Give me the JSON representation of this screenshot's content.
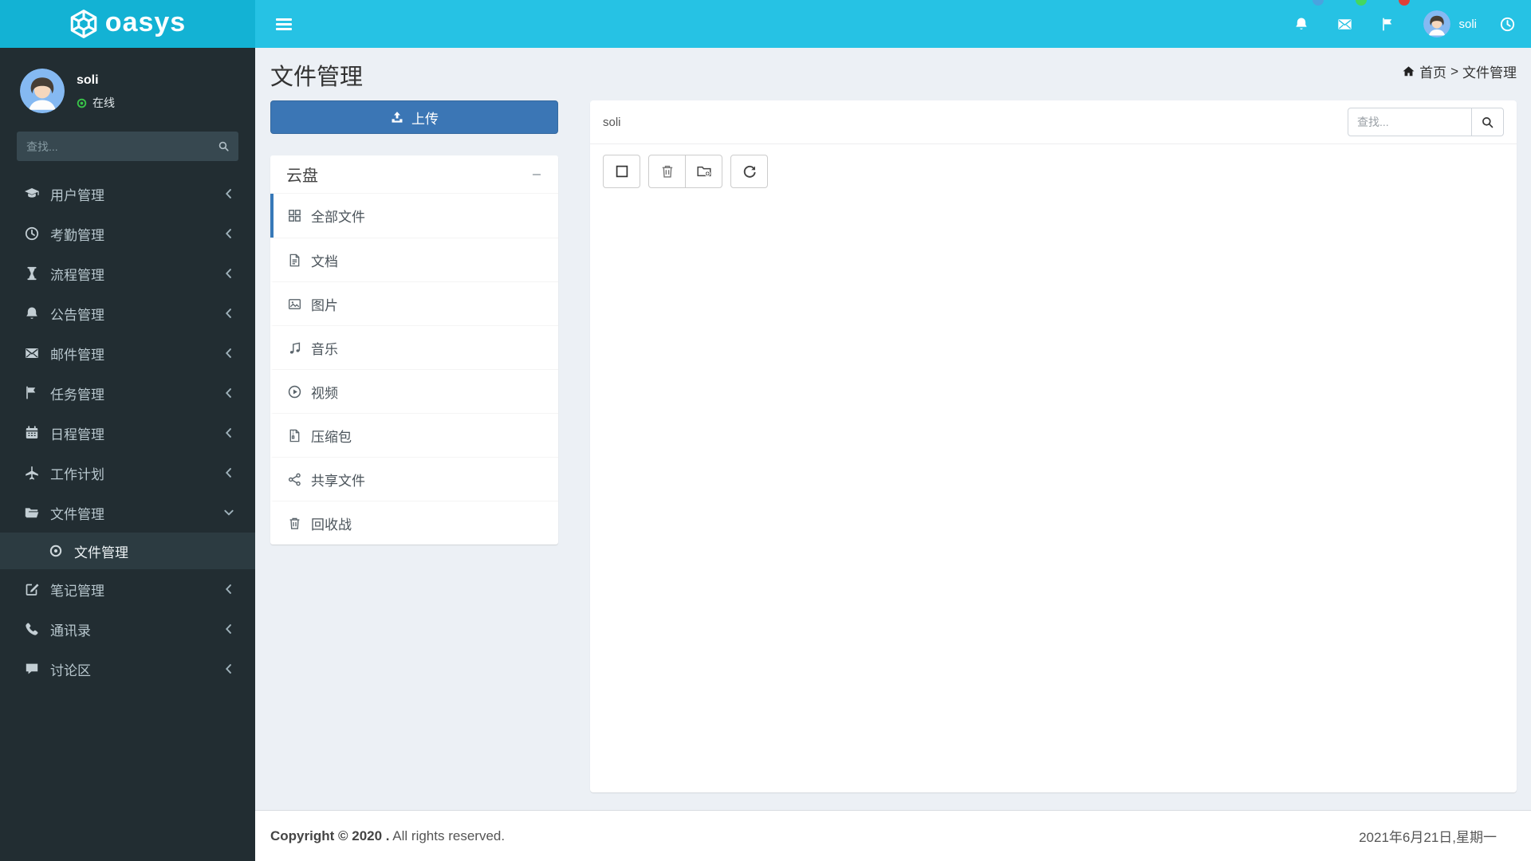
{
  "brand": {
    "logo_text": "oasys"
  },
  "topbar": {
    "username": "soli",
    "icons": [
      {
        "name": "bell",
        "badge_color": "#4aa3df"
      },
      {
        "name": "envelope",
        "badge_color": "#44d75f"
      },
      {
        "name": "flag",
        "badge_color": "#e04038"
      },
      {
        "name": "clock",
        "badge_color": null
      }
    ]
  },
  "sidebar": {
    "user": {
      "name": "soli",
      "status_label": "在线"
    },
    "search": {
      "placeholder": "查找..."
    },
    "items": [
      {
        "label": "用户管理",
        "icon": "graduation-cap"
      },
      {
        "label": "考勤管理",
        "icon": "clock"
      },
      {
        "label": "流程管理",
        "icon": "hourglass"
      },
      {
        "label": "公告管理",
        "icon": "bell"
      },
      {
        "label": "邮件管理",
        "icon": "envelope"
      },
      {
        "label": "任务管理",
        "icon": "flag"
      },
      {
        "label": "日程管理",
        "icon": "calendar"
      },
      {
        "label": "工作计划",
        "icon": "plane"
      },
      {
        "label": "文件管理",
        "icon": "folder-open",
        "expanded": true,
        "children": [
          {
            "label": "文件管理",
            "icon": "bullseye",
            "active": true
          }
        ]
      },
      {
        "label": "笔记管理",
        "icon": "edit"
      },
      {
        "label": "通讯录",
        "icon": "phone"
      },
      {
        "label": "讨论区",
        "icon": "comment"
      }
    ]
  },
  "page": {
    "title": "文件管理",
    "breadcrumb": {
      "home": "首页",
      "separator": ">",
      "current": "文件管理"
    }
  },
  "cloud": {
    "upload_label": "上传",
    "panel_title": "云盘",
    "items": [
      {
        "label": "全部文件",
        "icon": "grid",
        "active": true
      },
      {
        "label": "文档",
        "icon": "file-text"
      },
      {
        "label": "图片",
        "icon": "image"
      },
      {
        "label": "音乐",
        "icon": "music"
      },
      {
        "label": "视频",
        "icon": "play-circle"
      },
      {
        "label": "压缩包",
        "icon": "zip"
      },
      {
        "label": "共享文件",
        "icon": "share"
      },
      {
        "label": "回收战",
        "icon": "trash"
      }
    ]
  },
  "files": {
    "path_label": "soli",
    "search_placeholder": "查找...",
    "toolbar": [
      {
        "icon": "select-square"
      },
      {
        "icon": "trash"
      },
      {
        "icon": "folder-plus"
      },
      {
        "icon": "refresh"
      }
    ]
  },
  "footer": {
    "copyright_strong": "Copyright © 2020 .",
    "copyright_rest": " All rights reserved.",
    "date": "2021年6月21日,星期一"
  },
  "colors": {
    "navbar": "#26c2e4",
    "logo_bg": "#13b2d4",
    "sidebar_bg": "#222d32",
    "sidebar_active_bg": "#2c3b41",
    "accent_blue": "#3779b8",
    "upload_btn": "#3b76b5",
    "content_bg": "#ecf0f5",
    "online_green": "#39c449"
  }
}
